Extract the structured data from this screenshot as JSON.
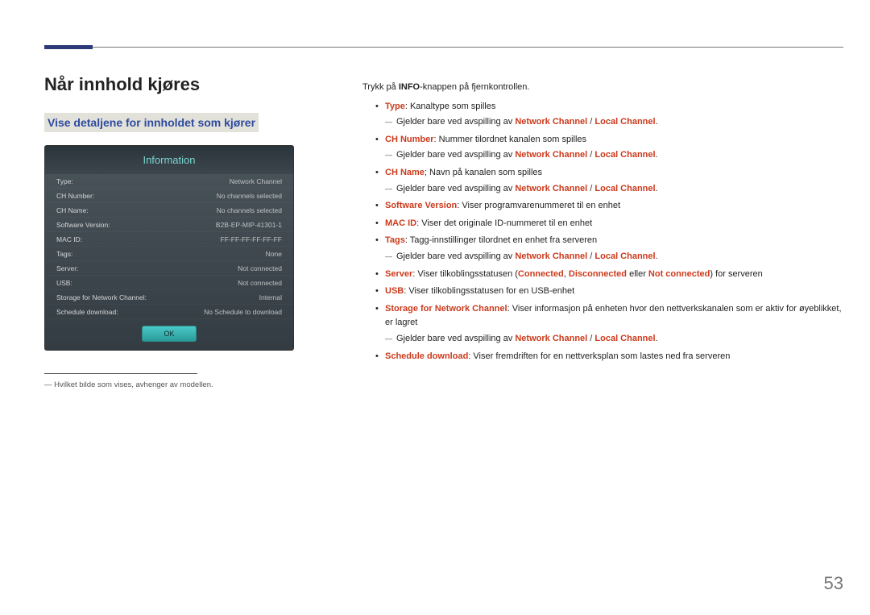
{
  "page_number": "53",
  "heading": "Når innhold kjøres",
  "subheading": "Vise detaljene for innholdet som kjører",
  "panel": {
    "title": "Information",
    "rows": [
      {
        "label": "Type:",
        "value": "Network Channel"
      },
      {
        "label": "CH Number:",
        "value": "No channels selected"
      },
      {
        "label": "CH Name:",
        "value": "No channels selected"
      },
      {
        "label": "Software Version:",
        "value": "B2B-EP-MIP-41301-1"
      },
      {
        "label": "MAC ID:",
        "value": "FF-FF-FF-FF-FF-FF"
      },
      {
        "label": "Tags:",
        "value": "None"
      },
      {
        "label": "Server:",
        "value": "Not connected"
      },
      {
        "label": "USB:",
        "value": "Not connected"
      },
      {
        "label": "Storage for Network Channel:",
        "value": "Internal"
      },
      {
        "label": "Schedule download:",
        "value": "No Schedule to download"
      }
    ],
    "ok_label": "OK"
  },
  "footnote": "Hvilket bilde som vises, avhenger av modellen.",
  "intro_pre": "Trykk på ",
  "intro_bold": "INFO",
  "intro_post": "-knappen på fjernkontrollen.",
  "tokens": {
    "network_channel": "Network Channel",
    "local_channel": "Local Channel",
    "connected": "Connected",
    "disconnected": "Disconnected",
    "not_connected": "Not connected",
    "applies_prefix": "Gjelder bare ved avspilling av "
  },
  "items": {
    "type": {
      "term": "Type",
      "desc": ": Kanaltype som spilles"
    },
    "ch_number": {
      "term": "CH Number",
      "desc": ": Nummer tilordnet kanalen som spilles"
    },
    "ch_name": {
      "term": "CH Name",
      "desc": "; Navn på kanalen som spilles"
    },
    "software": {
      "term": "Software Version",
      "desc": ": Viser programvarenummeret til en enhet"
    },
    "mac": {
      "term": "MAC ID",
      "desc": ": Viser det originale ID-nummeret til en enhet"
    },
    "tags": {
      "term": "Tags",
      "desc": ": Tagg-innstillinger tilordnet en enhet fra serveren"
    },
    "server": {
      "term": "Server",
      "desc_pre": ": Viser tilkoblingsstatusen (",
      "desc_post": ") for serveren"
    },
    "server_sep1": ", ",
    "server_sep2": " eller ",
    "usb": {
      "term": "USB",
      "desc": ": Viser tilkoblingsstatusen for en USB-enhet"
    },
    "storage": {
      "term": "Storage for Network Channel",
      "desc": ": Viser informasjon på enheten hvor den nettverkskanalen som er aktiv for øyeblikket, er lagret"
    },
    "schedule": {
      "term": "Schedule download",
      "desc": ": Viser fremdriften for en nettverksplan som lastes ned fra serveren"
    }
  }
}
